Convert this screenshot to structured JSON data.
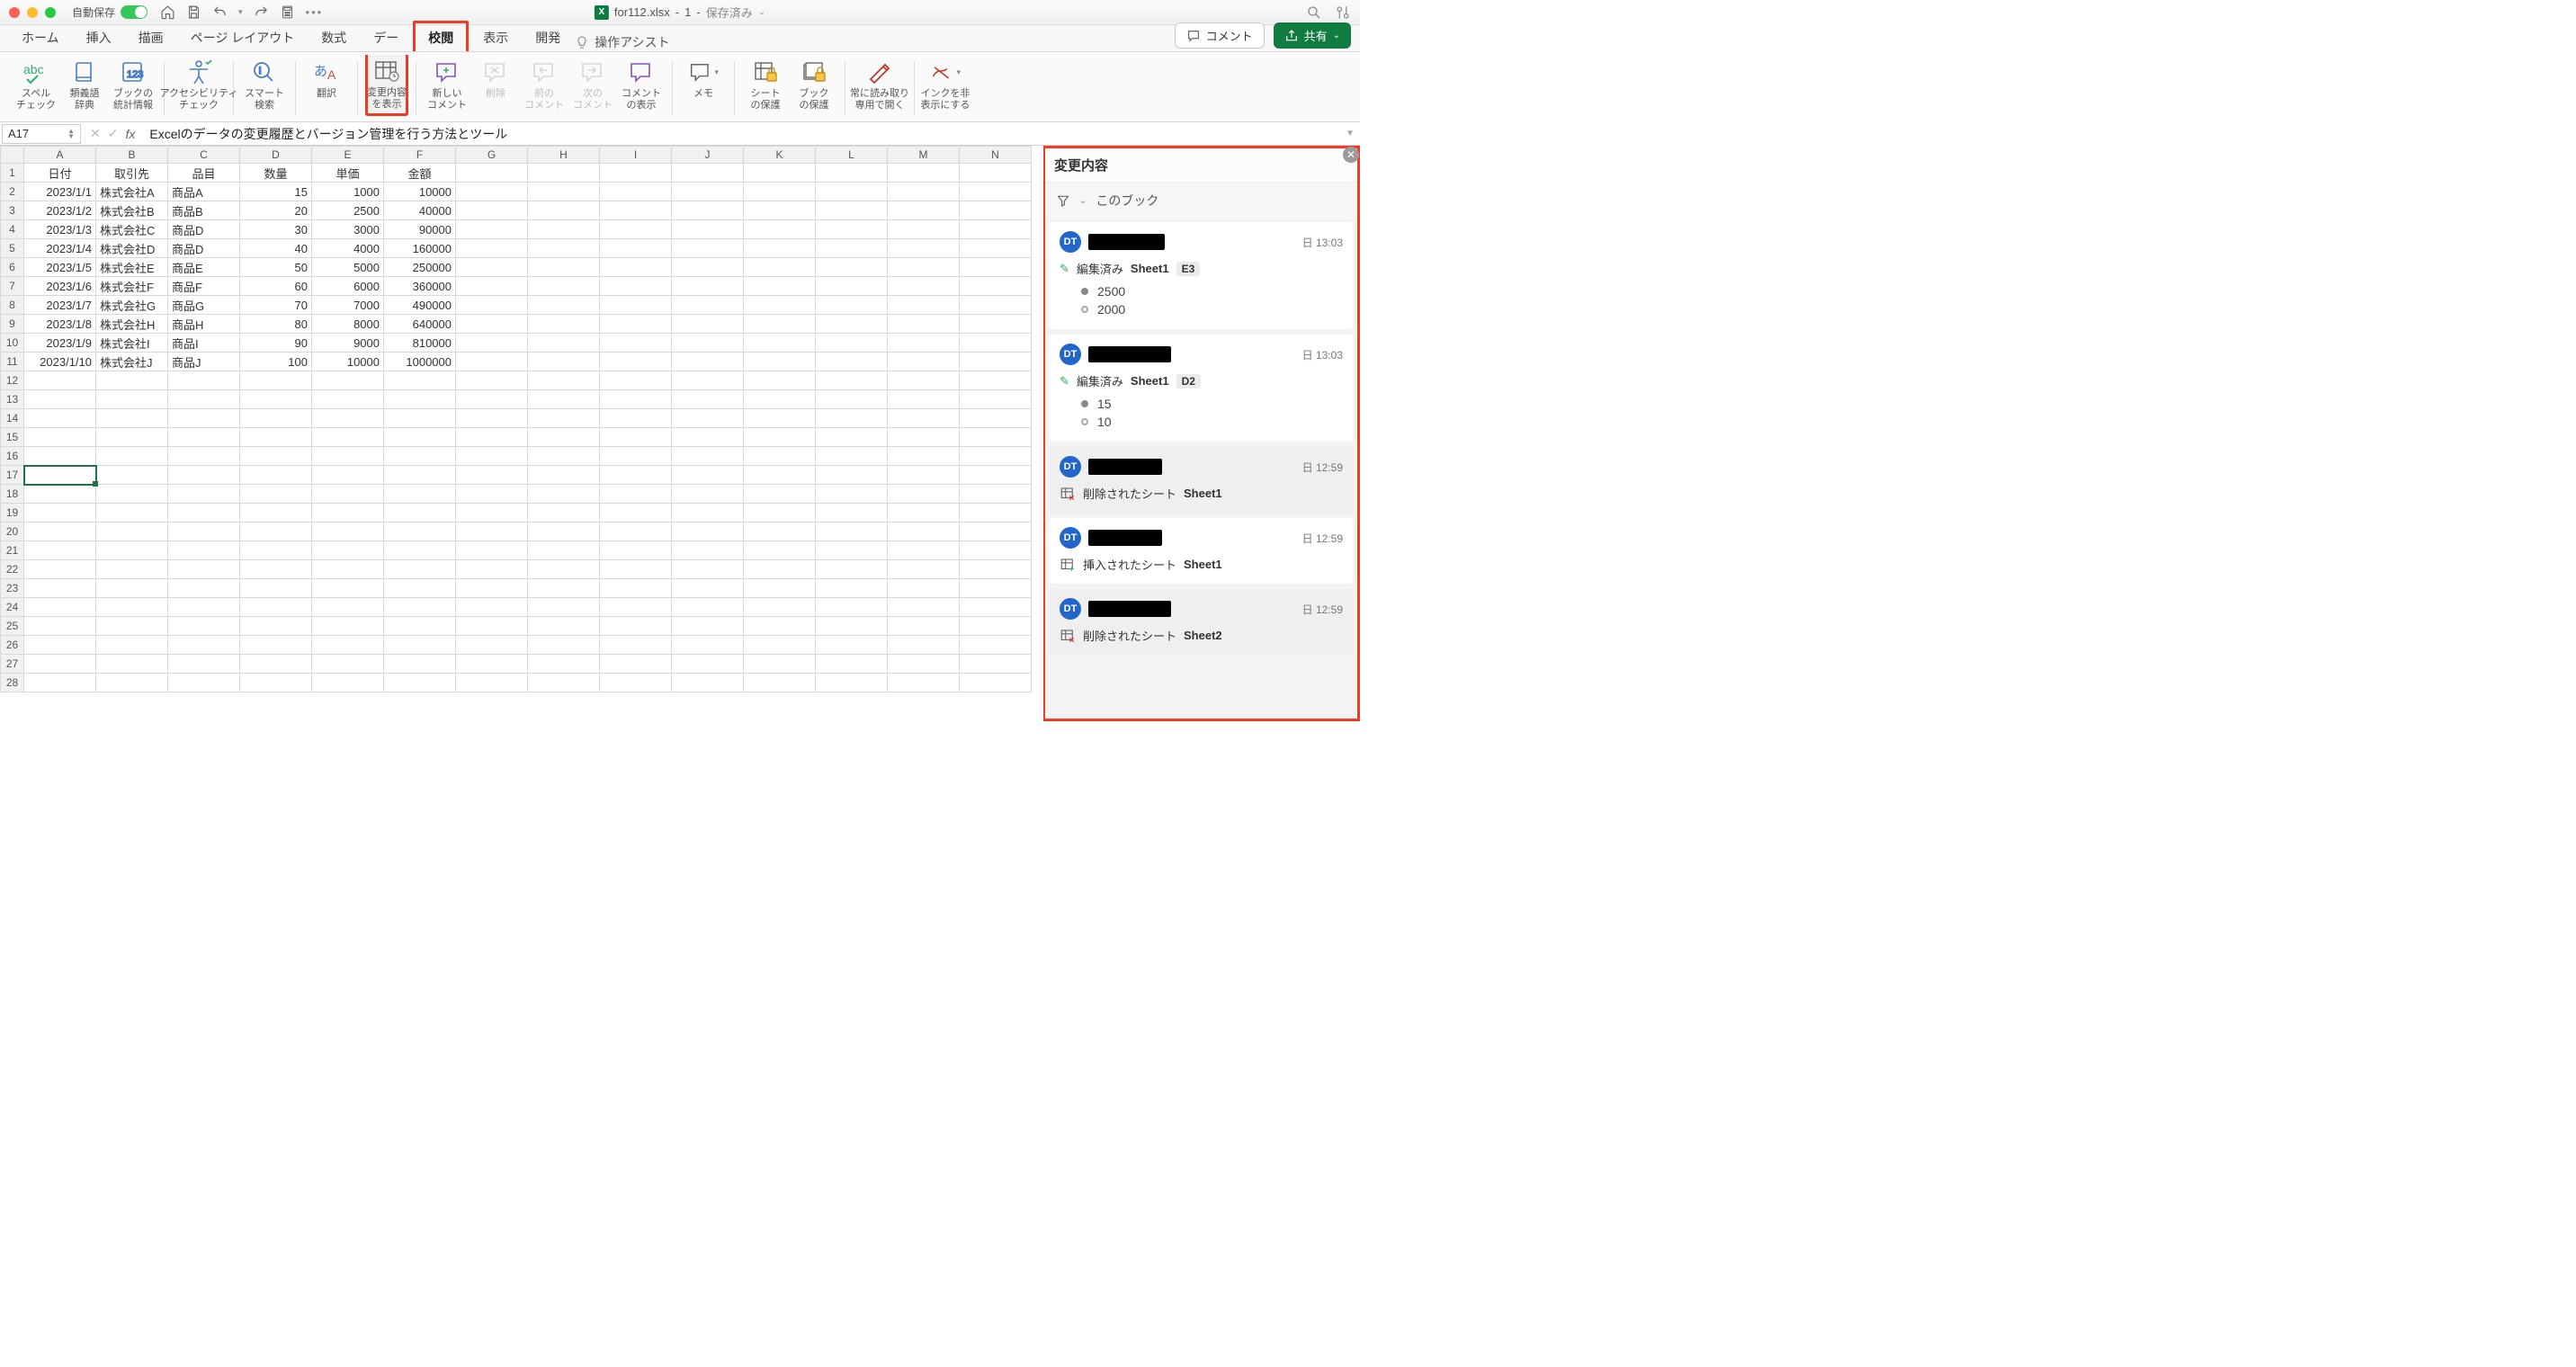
{
  "titlebar": {
    "autosave": "自動保存",
    "filename": "for112.xlsx",
    "docno": "1",
    "saved": "保存済み"
  },
  "tabs": {
    "home": "ホーム",
    "insert": "挿入",
    "draw": "描画",
    "layout": "ページ レイアウト",
    "formulas": "数式",
    "data": "デー",
    "review": "校閲",
    "view": "表示",
    "dev": "開発",
    "tellme": "操作アシスト",
    "comment_btn": "コメント",
    "share_btn": "共有"
  },
  "ribbon": {
    "spell": "スペル\nチェック",
    "thesaurus": "類義語\n辞典",
    "stats": "ブックの\n統計情報",
    "acc": "アクセシビリティ\nチェック",
    "smart": "スマート\n検索",
    "translate": "翻訳",
    "changes": "変更内容\nを表示",
    "newc": "新しい\nコメント",
    "del": "削除",
    "prev": "前の\nコメント",
    "next": "次の\nコメント",
    "showc": "コメント\nの表示",
    "memo": "メモ",
    "protect_s": "シート\nの保護",
    "protect_b": "ブック\nの保護",
    "readonly": "常に読み取り\n専用で開く",
    "ink": "インクを非\n表示にする"
  },
  "namebox": "A17",
  "formula": "Excelのデータの変更履歴とバージョン管理を行う方法とツール",
  "columns": [
    "A",
    "B",
    "C",
    "D",
    "E",
    "F",
    "G",
    "H",
    "I",
    "J",
    "K",
    "L",
    "M",
    "N"
  ],
  "headers": [
    "日付",
    "取引先",
    "品目",
    "数量",
    "単価",
    "金額"
  ],
  "rows": [
    [
      "2023/1/1",
      "株式会社A",
      "商品A",
      "15",
      "1000",
      "10000"
    ],
    [
      "2023/1/2",
      "株式会社B",
      "商品B",
      "20",
      "2500",
      "40000"
    ],
    [
      "2023/1/3",
      "株式会社C",
      "商品D",
      "30",
      "3000",
      "90000"
    ],
    [
      "2023/1/4",
      "株式会社D",
      "商品D",
      "40",
      "4000",
      "160000"
    ],
    [
      "2023/1/5",
      "株式会社E",
      "商品E",
      "50",
      "5000",
      "250000"
    ],
    [
      "2023/1/6",
      "株式会社F",
      "商品F",
      "60",
      "6000",
      "360000"
    ],
    [
      "2023/1/7",
      "株式会社G",
      "商品G",
      "70",
      "7000",
      "490000"
    ],
    [
      "2023/1/8",
      "株式会社H",
      "商品H",
      "80",
      "8000",
      "640000"
    ],
    [
      "2023/1/9",
      "株式会社I",
      "商品I",
      "90",
      "9000",
      "810000"
    ],
    [
      "2023/1/10",
      "株式会社J",
      "商品J",
      "100",
      "10000",
      "1000000"
    ]
  ],
  "panel": {
    "title": "変更内容",
    "filter": "このブック",
    "edited": "編集済み",
    "sheet1": "Sheet1",
    "sheet2": "Sheet2",
    "deleted": "削除されたシート",
    "inserted": "挿入されたシート",
    "avatar": "DT",
    "items": [
      {
        "time": "日 13:03",
        "uwidth": 85,
        "kind": "edit",
        "cell": "E3",
        "new": "2500",
        "old": "2000"
      },
      {
        "time": "日 13:03",
        "uwidth": 92,
        "kind": "edit",
        "cell": "D2",
        "new": "15",
        "old": "10"
      },
      {
        "time": "日 12:59",
        "uwidth": 82,
        "kind": "deleted",
        "sheet": "Sheet1",
        "g": true
      },
      {
        "time": "日 12:59",
        "uwidth": 82,
        "kind": "inserted",
        "sheet": "Sheet1"
      },
      {
        "time": "日 12:59",
        "uwidth": 92,
        "kind": "deleted",
        "sheet": "Sheet2",
        "g": true
      }
    ]
  }
}
